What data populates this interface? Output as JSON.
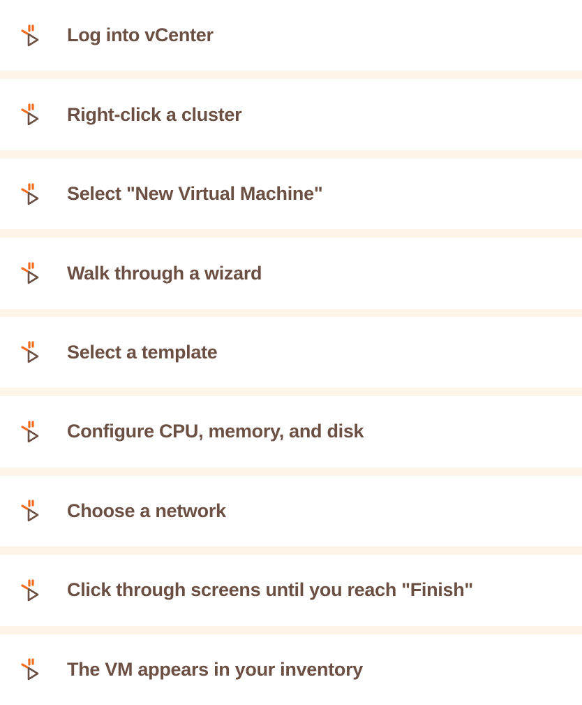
{
  "colors": {
    "text": "#6b4f43",
    "accent": "#f26a1b",
    "separator": "#fdf5e8",
    "background": "#ffffff"
  },
  "steps": [
    {
      "label": "Log into vCenter",
      "icon": "click-cursor-icon"
    },
    {
      "label": "Right-click a cluster",
      "icon": "click-cursor-icon"
    },
    {
      "label": "Select \"New Virtual Machine\"",
      "icon": "click-cursor-icon"
    },
    {
      "label": "Walk through a wizard",
      "icon": "click-cursor-icon"
    },
    {
      "label": "Select a template",
      "icon": "click-cursor-icon"
    },
    {
      "label": "Configure CPU, memory, and disk",
      "icon": "click-cursor-icon"
    },
    {
      "label": "Choose a network",
      "icon": "click-cursor-icon"
    },
    {
      "label": "Click through screens until you reach \"Finish\"",
      "icon": "click-cursor-icon"
    },
    {
      "label": "The VM appears in your inventory",
      "icon": "click-cursor-icon"
    }
  ]
}
